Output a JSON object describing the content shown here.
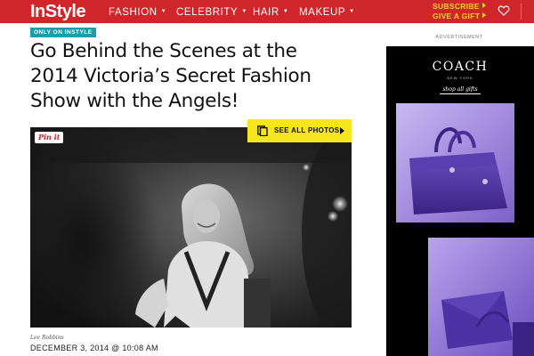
{
  "nav": {
    "logo": "InStyle",
    "items": [
      {
        "label": "FASHION"
      },
      {
        "label": "CELEBRITY"
      },
      {
        "label": "HAIR"
      },
      {
        "label": "MAKEUP"
      }
    ],
    "subscribe_label": "SUBSCRIBE",
    "gift_label": "GIVE A GIFT",
    "favorites_icon": "heart-icon"
  },
  "article": {
    "tag": "ONLY ON INSTYLE",
    "headline_lines": [
      "Go Behind the Scenes at the",
      "2014 Victoria’s Secret Fashion",
      "Show with the Angels!"
    ],
    "pin_label": "Pin it",
    "see_all_label": "SEE ALL PHOTOS",
    "photo_credit": "Lee Robbins",
    "date": "DECEMBER 3, 2014 @ 10:08 AM"
  },
  "ad": {
    "label": "ADVERTISEMENT",
    "brand": "COACH",
    "brand_sub": "NEW YORK",
    "cta": "shop all gifts"
  },
  "colors": {
    "nav_bg": "#d0252a",
    "subscribe": "#f7d428",
    "tag_bg": "#1a9fa8",
    "see_all_bg": "#f7e520",
    "ad_purple": "#5b3fa8"
  }
}
